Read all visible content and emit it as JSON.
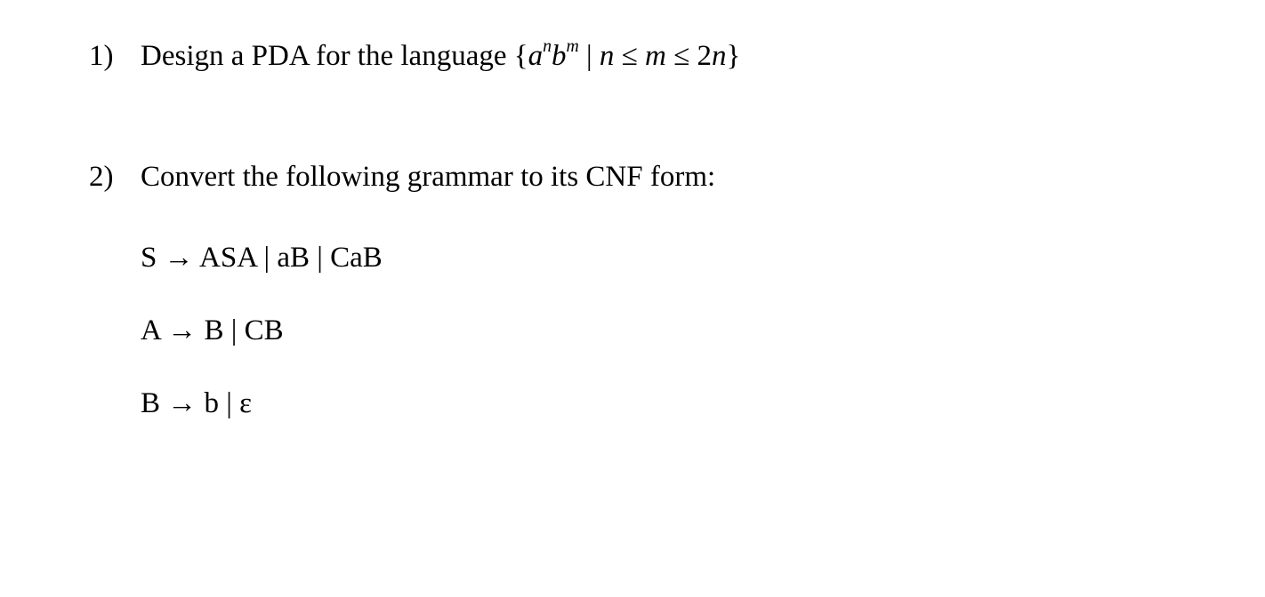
{
  "problem1": {
    "number": "1)",
    "prefix": "Design a PDA for the language ",
    "set_open": "{",
    "a": "a",
    "exp_n1": "n",
    "b": "b",
    "exp_m1": "m",
    "bar": " | ",
    "n2": "n",
    "leq1": " ≤ ",
    "m2": "m",
    "leq2": " ≤ ",
    "two": "2",
    "n3": "n",
    "set_close": "}"
  },
  "problem2": {
    "number": "2)",
    "text": "Convert the following grammar to its CNF form:",
    "rules": {
      "r1": "S → ASA | aB | CaB",
      "r2": "A → B | CB",
      "r3": "B → b | ε"
    }
  }
}
